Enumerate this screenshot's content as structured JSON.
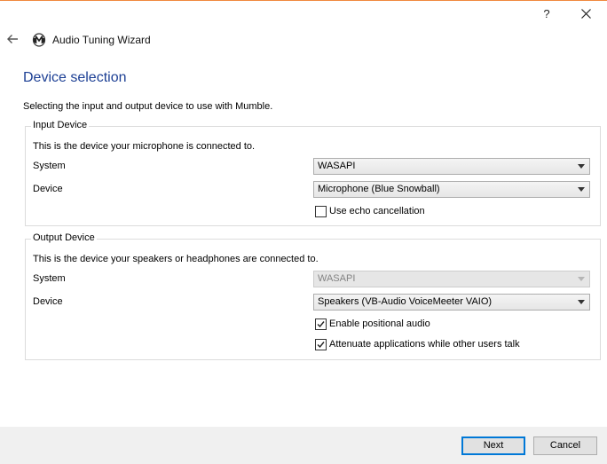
{
  "window": {
    "help_glyph": "?",
    "title": "Audio Tuning Wizard"
  },
  "page": {
    "title": "Device selection",
    "description": "Selecting the input and output device to use with Mumble."
  },
  "input_device": {
    "group_title": "Input Device",
    "description": "This is the device your microphone is connected to.",
    "system_label": "System",
    "system_value": "WASAPI",
    "device_label": "Device",
    "device_value": "Microphone (Blue Snowball)",
    "echo_cancellation": {
      "label": "Use echo cancellation",
      "checked": false
    }
  },
  "output_device": {
    "group_title": "Output Device",
    "description": "This is the device your speakers or headphones are connected to.",
    "system_label": "System",
    "system_value": "WASAPI",
    "system_disabled": true,
    "device_label": "Device",
    "device_value": "Speakers (VB-Audio VoiceMeeter VAIO)",
    "positional_audio": {
      "label": "Enable positional audio",
      "checked": true
    },
    "attenuate": {
      "label": "Attenuate applications while other users talk",
      "checked": true
    }
  },
  "footer": {
    "next_label": "Next",
    "cancel_label": "Cancel"
  },
  "colors": {
    "accent": "#0078d7",
    "title_blue": "#1c3f94",
    "window_border": "#f0883e"
  }
}
